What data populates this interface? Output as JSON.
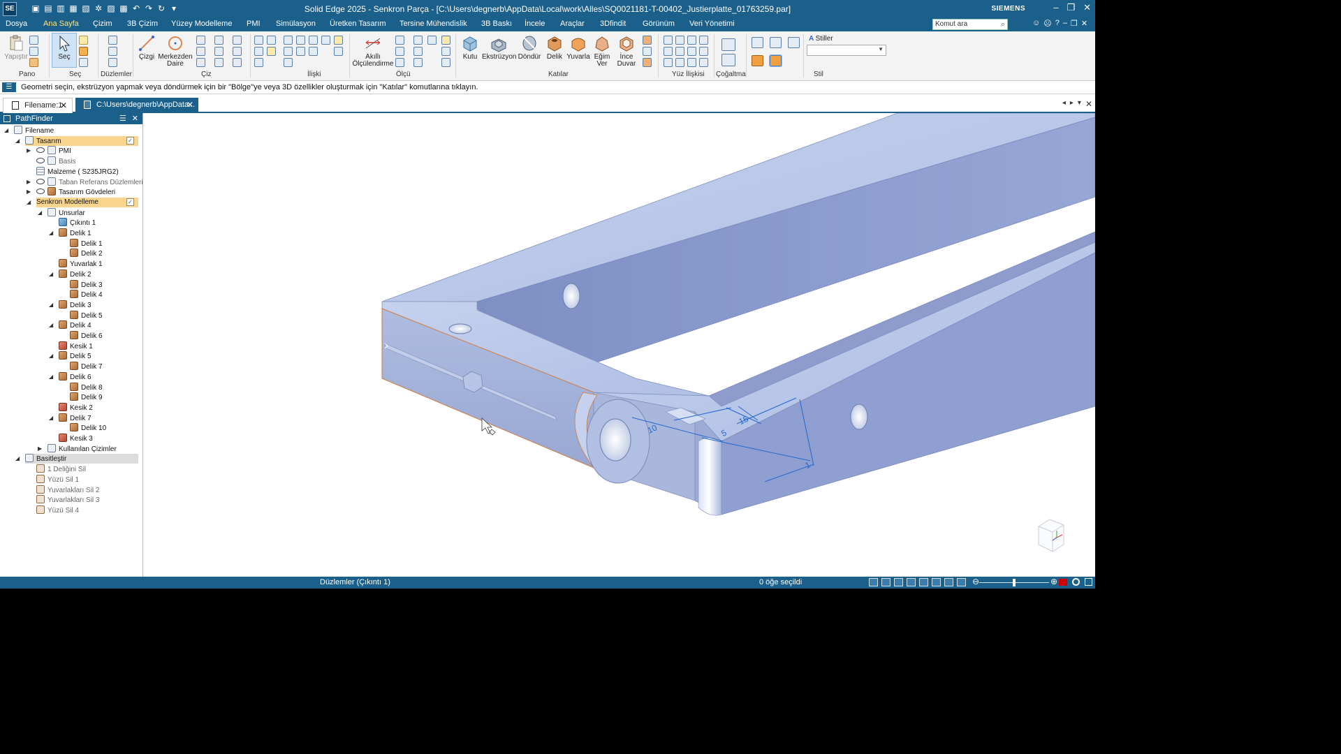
{
  "titlebar": {
    "app_title": "Solid Edge 2025 - Senkron Parça - [C:\\Users\\degnerb\\AppData\\Local\\work\\Alles\\SQ0021181-T-00402_Justierplatte_01763259.par]",
    "brand": "SIEMENS",
    "logo": "SE"
  },
  "menu": {
    "tabs": [
      "Dosya",
      "Ana Sayfa",
      "Çizim",
      "3B Çizim",
      "Yüzey Modelleme",
      "PMI",
      "Simülasyon",
      "Üretken Tasarım",
      "Tersine Mühendislik",
      "3B Baskı",
      "İncele",
      "Araçlar",
      "3Dfindit",
      "Görünüm",
      "Veri Yönetimi"
    ],
    "active": "Ana Sayfa",
    "command_search_placeholder": "Komut ara"
  },
  "ribbon": {
    "paste_label": "Yapıştır",
    "select_label": "Seç",
    "line_label": "Çizgi",
    "center_circle_label": "Merkezden Daire",
    "smart_dim_label": "Akıllı Ölçülendirme",
    "box_label": "Kutu",
    "extrude_label": "Ekstrüzyon",
    "revolve_label": "Döndür",
    "hole_label": "Delik",
    "round_label": "Yuvarla",
    "draft_label": "Eğim Ver",
    "thin_wall_label": "İnce Duvar",
    "styles_label": "Stiller",
    "groups": {
      "clipboard": "Pano",
      "select": "Seç",
      "planes": "Düzlemler",
      "draw": "Çiz",
      "relate": "İlişki",
      "dimension": "Ölçü",
      "solids": "Katılar",
      "face_relate": "Yüz İlişkisi",
      "pattern": "Çoğaltma",
      "style": "Stil"
    }
  },
  "prompt": {
    "text": "Geometri seçin, ekstrüzyon yapmak veya döndürmek için bir \"Bölge\"ye veya 3D özellikler oluşturmak için \"Katılar\" komutlarına tıklayın."
  },
  "doctabs": {
    "tab1": "Filename:1",
    "tab2": "C:\\Users\\degnerb\\AppData..."
  },
  "pathfinder": {
    "title": "PathFinder",
    "tree": [
      {
        "label": "Filename",
        "level": 0,
        "icon": "doc",
        "expander": "open"
      },
      {
        "label": "Tasarım",
        "level": 1,
        "icon": "doc",
        "expander": "open",
        "highlight": true
      },
      {
        "label": "PMI",
        "level": 2,
        "icon": "pmi",
        "expander": "closed",
        "eye": true
      },
      {
        "label": "Basis",
        "level": 2,
        "icon": "sketch",
        "dim": true,
        "eye": true
      },
      {
        "label": "Malzeme ( S235JRG2)",
        "level": 2,
        "icon": "grid"
      },
      {
        "label": "Taban Referans Düzlemleri",
        "level": 2,
        "icon": "planes",
        "expander": "closed",
        "eye": true,
        "dim": true
      },
      {
        "label": "Tasarım Gövdeleri",
        "level": 2,
        "icon": "bodies",
        "expander": "closed",
        "eye": true
      },
      {
        "label": "Senkron Modelleme",
        "level": 2,
        "icon": "none",
        "expander": "open",
        "highlight": true
      },
      {
        "label": "Unsurlar",
        "level": 3,
        "icon": "doc",
        "expander": "open"
      },
      {
        "label": "Çıkıntı 1",
        "level": 4,
        "icon": "cubeb"
      },
      {
        "label": "Delik 1",
        "level": 4,
        "icon": "cube",
        "expander": "open"
      },
      {
        "label": "Delik 1",
        "level": 5,
        "icon": "cube"
      },
      {
        "label": "Delik 2",
        "level": 5,
        "icon": "cube"
      },
      {
        "label": "Yuvarlak 1",
        "level": 4,
        "icon": "cube"
      },
      {
        "label": "Delik 2",
        "level": 4,
        "icon": "cube",
        "expander": "open"
      },
      {
        "label": "Delik 3",
        "level": 5,
        "icon": "cube"
      },
      {
        "label": "Delik 4",
        "level": 5,
        "icon": "cube"
      },
      {
        "label": "Delik 3",
        "level": 4,
        "icon": "cube",
        "expander": "open"
      },
      {
        "label": "Delik 5",
        "level": 5,
        "icon": "cube"
      },
      {
        "label": "Delik 4",
        "level": 4,
        "icon": "cube",
        "expander": "open"
      },
      {
        "label": "Delik 6",
        "level": 5,
        "icon": "cube"
      },
      {
        "label": "Kesik 1",
        "level": 4,
        "icon": "cuber"
      },
      {
        "label": "Delik 5",
        "level": 4,
        "icon": "cube",
        "expander": "open"
      },
      {
        "label": "Delik 7",
        "level": 5,
        "icon": "cube"
      },
      {
        "label": "Delik 6",
        "level": 4,
        "icon": "cube",
        "expander": "open"
      },
      {
        "label": "Delik 8",
        "level": 5,
        "icon": "cube"
      },
      {
        "label": "Delik 9",
        "level": 5,
        "icon": "cube"
      },
      {
        "label": "Kesik 2",
        "level": 4,
        "icon": "cuber"
      },
      {
        "label": "Delik 7",
        "level": 4,
        "icon": "cube",
        "expander": "open"
      },
      {
        "label": "Delik 10",
        "level": 5,
        "icon": "cube"
      },
      {
        "label": "Kesik 3",
        "level": 4,
        "icon": "cuber"
      },
      {
        "label": "Kullanılan Çizimler",
        "level": 3,
        "icon": "sketch",
        "expander": "closed"
      },
      {
        "label": "Basitleştir",
        "level": 1,
        "icon": "simplify",
        "expander": "open",
        "highlight2": true
      },
      {
        "label": "1 Deliğini Sil",
        "level": 2,
        "icon": "del",
        "dim": true
      },
      {
        "label": "Yüzü Sil 1",
        "level": 2,
        "icon": "del",
        "dim": true
      },
      {
        "label": "Yuvarlakları Sil 2",
        "level": 2,
        "icon": "del",
        "dim": true
      },
      {
        "label": "Yuvarlakları Sil 3",
        "level": 2,
        "icon": "del",
        "dim": true
      },
      {
        "label": "Yüzü Sil 4",
        "level": 2,
        "icon": "del",
        "dim": true
      }
    ]
  },
  "viewport": {
    "dimensions": [
      "15",
      "5",
      "10",
      "1"
    ]
  },
  "status": {
    "left": "Düzlemler (Çıkıntı 1)",
    "center": "0 öğe seçildi"
  },
  "colors": {
    "chrome_blue": "#1b5f8b",
    "part_top": "#b8c6e6",
    "part_side": "#a3b2d9",
    "part_dark": "#8c9bcc",
    "dim_blue": "#2266cc",
    "edge_orange": "#e07a3a",
    "highlight_yellow": "#f9d58e"
  }
}
